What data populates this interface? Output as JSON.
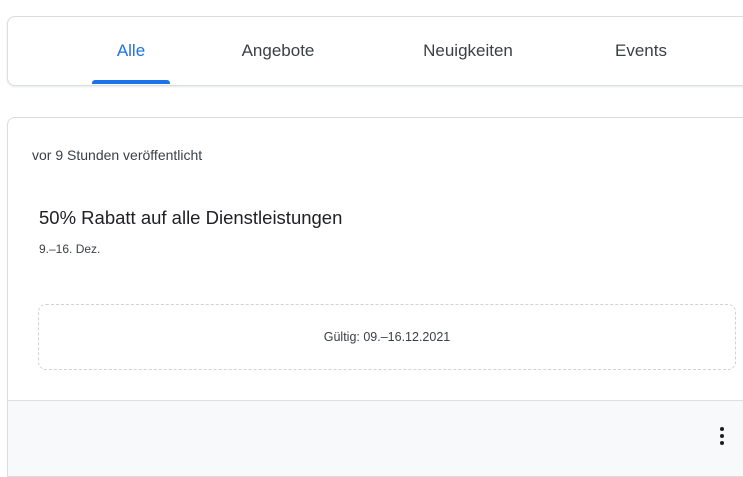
{
  "tabs": [
    {
      "label": "Alle",
      "active": true
    },
    {
      "label": "Angebote",
      "active": false
    },
    {
      "label": "Neuigkeiten",
      "active": false
    },
    {
      "label": "Events",
      "active": false
    }
  ],
  "post": {
    "posted_time": "vor 9 Stunden veröffentlicht",
    "title": "50% Rabatt auf alle Dienstleistungen",
    "date_range": "9.–16. Dez.",
    "validity": "Gültig: 09.–16.12.2021",
    "more_icon": "more-vert-icon"
  },
  "colors": {
    "accent": "#1a73e8",
    "text": "#202124",
    "secondary_text": "#3c4043",
    "border": "#dadce0",
    "footer_bg": "#f8f9fa"
  }
}
